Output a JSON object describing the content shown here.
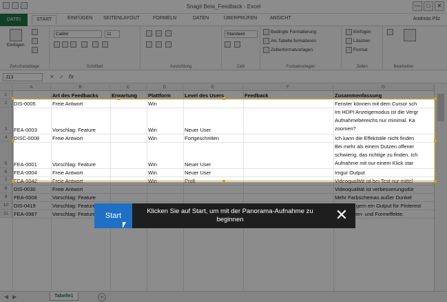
{
  "window": {
    "title": "Snagit Beta_Feedback - Excel",
    "minimize": "—",
    "restore": "□",
    "close": "✕"
  },
  "ribbon_tabs": [
    "DATEI",
    "START",
    "EINFÜGEN",
    "SEITENLAYOUT",
    "FORMELN",
    "DATEN",
    "ÜBERPRÜFEN",
    "ANSICHT"
  ],
  "user": "Andreas Pilz",
  "ribbon": {
    "clipboard": {
      "paste": "Einfügen",
      "label": "Zwischenablage"
    },
    "font": {
      "name": "Calibri",
      "size": "11",
      "label": "Schriftart"
    },
    "alignment": {
      "label": "Ausrichtung"
    },
    "number": {
      "format": "Standard",
      "label": "Zahl"
    },
    "styles": {
      "cond": "Bedingte Formatierung",
      "table": "Als Tabelle formatieren",
      "cell": "Zellenformatvorlagen",
      "label": "Formatvorlagen"
    },
    "cells": {
      "insert": "Einfügen",
      "delete": "Löschen",
      "format": "Format",
      "label": "Zellen"
    },
    "edit": {
      "label": "Bearbeiten"
    }
  },
  "formula_bar": {
    "namebox": "J13",
    "fx": "fx",
    "cancel": "✕",
    "enter": "✓"
  },
  "columns": [
    "A",
    "B",
    "C",
    "D",
    "E",
    "F",
    "G"
  ],
  "headers": [
    "",
    "Art des Feedbacks",
    "Erwartung",
    "Plattform",
    "Level des Users",
    "Feedback",
    "Zusammenfassung"
  ],
  "rows": [
    {
      "num": "2",
      "cells": [
        "DIS-0005",
        "Freie Antwort",
        "",
        "Win",
        "",
        "",
        "Fenster können mit dem Cursor sch"
      ]
    },
    {
      "num": "3",
      "cells": [
        "FEA-0003",
        "Vorschlag: Feature",
        "",
        "Win",
        "Neuer User",
        "",
        "Im HDPI Anzeigemodus ist die Vergr"
      ],
      "extra": [
        "Aufnahmebereichs nur minimal. Ka",
        "zoomen?"
      ]
    },
    {
      "num": "4",
      "cells": [
        "DISC-0008",
        "Freie Antwort",
        "",
        "Win",
        "Fortgeschritten",
        "",
        "Ich kann die Effektstile nicht finden"
      ]
    },
    {
      "num": "5",
      "cells": [
        "FEA-0001",
        "Vorschlag: Feature",
        "",
        "Win",
        "Neuer User",
        "",
        "Bei mehr als einem Dutzen offener"
      ],
      "extra": [
        "schwierig, das richtige zu finden. Ich",
        "Aufnahme mit nur einem Klick  star"
      ]
    },
    {
      "num": "6",
      "cells": [
        "FEA-0004",
        "Freie Antwort",
        "",
        "Win",
        "Neuer User",
        "",
        "Imgur Output"
      ]
    },
    {
      "num": "7",
      "cells": [
        "FEA-0042",
        "Freie Antwort",
        "",
        "Win",
        "Profi",
        "",
        "Videoqualität ist bei Text nur mittel"
      ]
    },
    {
      "num": "8",
      "cells": [
        "DIS-0030",
        "Freie Antwort",
        "",
        "",
        "",
        "",
        "Videoqualität ist verbesserungsdür"
      ]
    },
    {
      "num": "9",
      "cells": [
        "FEA-0008",
        "Vorschlag: Feature",
        "",
        "",
        "",
        "",
        "Mehr Farbschemas außer Dunkel"
      ]
    },
    {
      "num": "10",
      "cells": [
        "DIS-0419",
        "Vorschlag: Feature",
        "",
        "",
        "",
        "",
        "Ich hätte gern ein Output für Pinterest"
      ]
    },
    {
      "num": "11",
      "cells": [
        "FEA-0987",
        "Vorschlag: Feature",
        "",
        "",
        "",
        "",
        "Mehr Linien- und Formeffekte."
      ]
    }
  ],
  "sheet_tab": "Tabelle1",
  "add_sheet": "+",
  "toast": {
    "start": "Start",
    "message": "Klicken Sie auf Start, um mit der Panorama-Aufnahme zu beginnen",
    "close": "✕"
  }
}
